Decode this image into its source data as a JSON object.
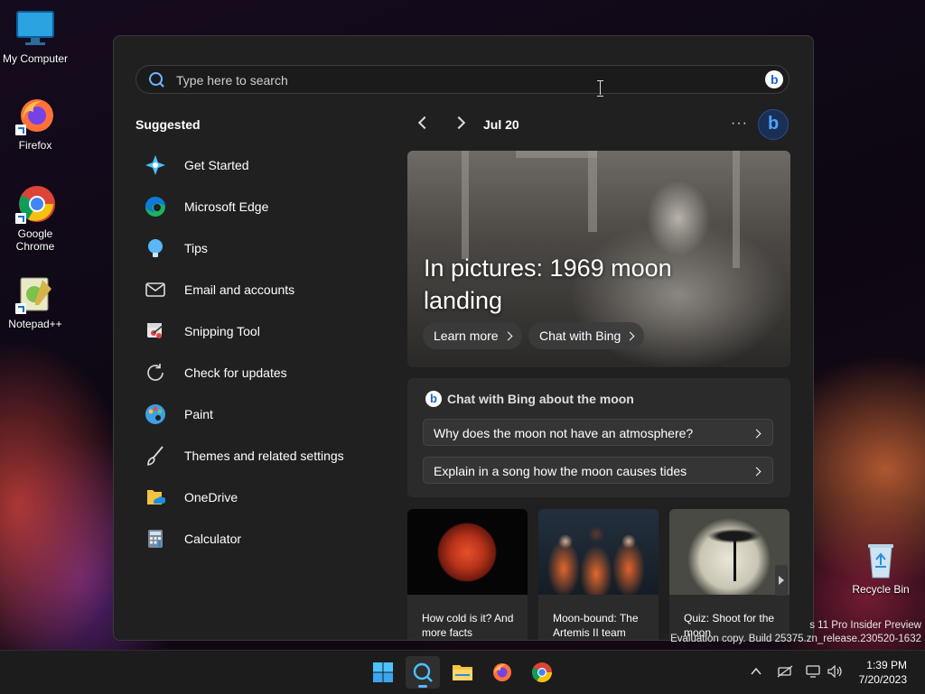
{
  "desktop": {
    "icons": [
      {
        "label": "My Computer"
      },
      {
        "label": "Firefox"
      },
      {
        "label": "Google Chrome"
      },
      {
        "label": "Notepad++"
      },
      {
        "label": "Recycle Bin"
      }
    ]
  },
  "search": {
    "placeholder": "Type here to search"
  },
  "suggested": {
    "title": "Suggested",
    "items": [
      {
        "label": "Get Started",
        "icon": "get-started-icon"
      },
      {
        "label": "Microsoft Edge",
        "icon": "edge-icon"
      },
      {
        "label": "Tips",
        "icon": "tips-icon"
      },
      {
        "label": "Email and accounts",
        "icon": "mail-icon"
      },
      {
        "label": "Snipping Tool",
        "icon": "snipping-tool-icon"
      },
      {
        "label": "Check for updates",
        "icon": "refresh-icon"
      },
      {
        "label": "Paint",
        "icon": "paint-icon"
      },
      {
        "label": "Themes and related settings",
        "icon": "brush-icon"
      },
      {
        "label": "OneDrive",
        "icon": "onedrive-icon"
      },
      {
        "label": "Calculator",
        "icon": "calculator-icon"
      }
    ]
  },
  "highlights": {
    "date": "Jul 20",
    "more": "···",
    "hero": {
      "title": "In pictures: 1969 moon landing",
      "learn_more": "Learn more",
      "chat_with_bing": "Chat with Bing"
    },
    "chat": {
      "heading": "Chat with Bing about the moon",
      "questions": [
        "Why does the moon not have an atmosphere?",
        "Explain in a song how the moon causes tides"
      ]
    },
    "cards": [
      {
        "caption": "How cold is it? And more facts"
      },
      {
        "caption": "Moon-bound: The Artemis II team"
      },
      {
        "caption": "Quiz: Shoot for the moon"
      }
    ]
  },
  "watermark": {
    "line1": "s 11 Pro Insider Preview",
    "line2": "Evaluation copy. Build 25375.zn_release.230520-1632"
  },
  "taskbar": {
    "time": "1:39 PM",
    "date": "7/20/2023"
  },
  "colors": {
    "accent": "#5fb2f2",
    "panel_bg": "#202020",
    "card_bg": "#2b2b2b"
  }
}
